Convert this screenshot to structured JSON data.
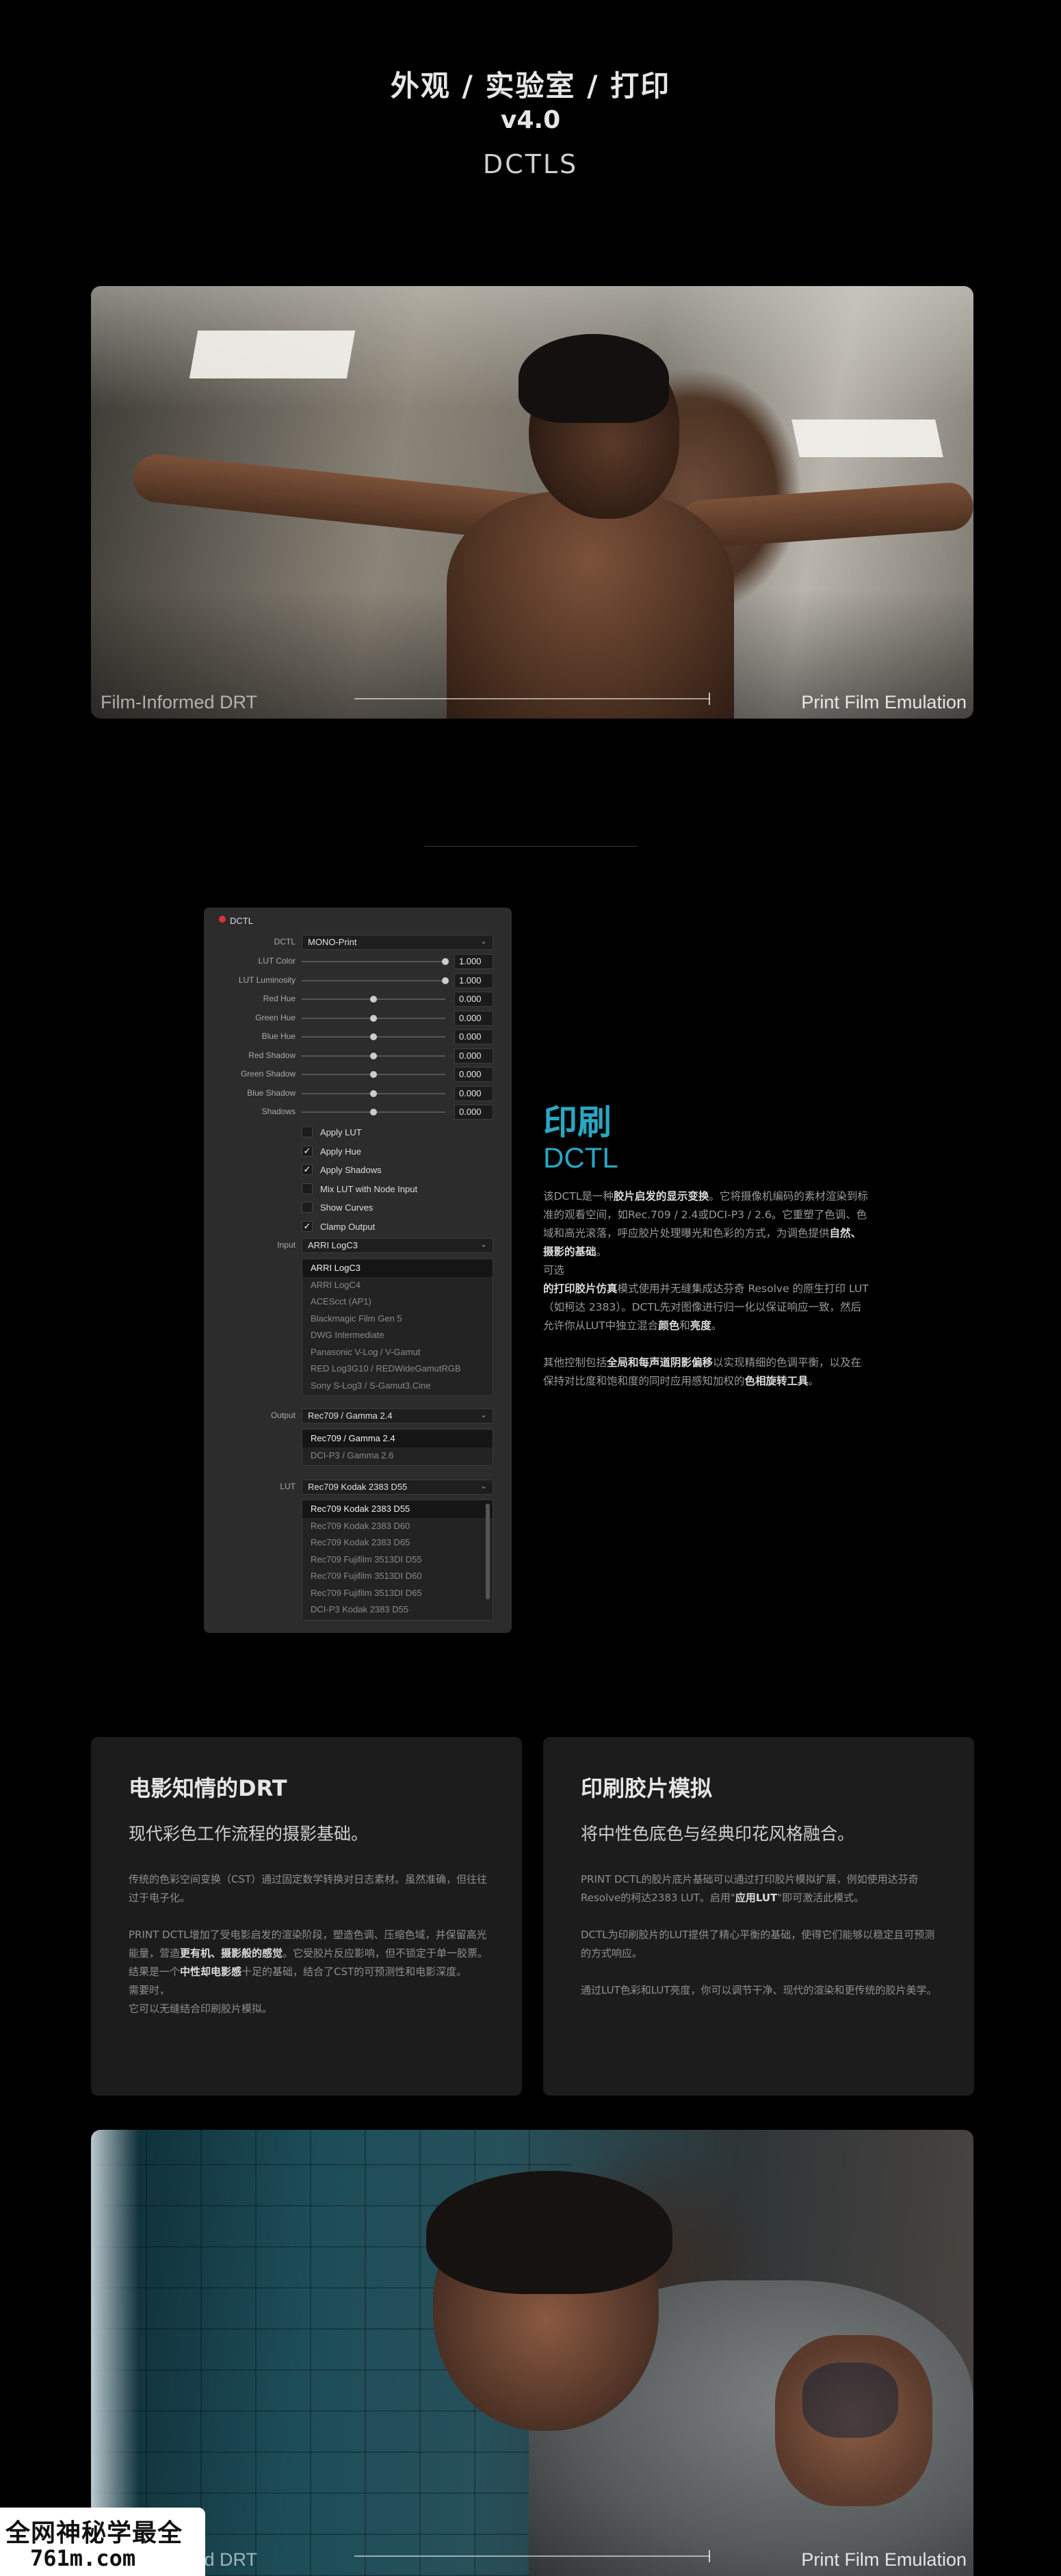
{
  "header": {
    "title": "外观 / 实验室 / 打印",
    "version": "v4.0",
    "subtitle": "DCTLS"
  },
  "hero1": {
    "caption_left": "Film-Informed DRT",
    "caption_right": "Print Film Emulation"
  },
  "panel": {
    "title": "DCTL",
    "dctl_label": "DCTL",
    "dctl_value": "MONO-Print",
    "sliders": [
      {
        "label": "LUT Color",
        "value": "1.000",
        "level": 1.0
      },
      {
        "label": "LUT Luminosity",
        "value": "1.000",
        "level": 1.0
      },
      {
        "label": "Red Hue",
        "value": "0.000",
        "level": 0.5
      },
      {
        "label": "Green Hue",
        "value": "0.000",
        "level": 0.5
      },
      {
        "label": "Blue Hue",
        "value": "0.000",
        "level": 0.5
      },
      {
        "label": "Red Shadow",
        "value": "0.000",
        "level": 0.5
      },
      {
        "label": "Green Shadow",
        "value": "0.000",
        "level": 0.5
      },
      {
        "label": "Blue Shadow",
        "value": "0.000",
        "level": 0.5
      },
      {
        "label": "Shadows",
        "value": "0.000",
        "level": 0.5
      }
    ],
    "checkboxes": [
      {
        "label": "Apply LUT",
        "checked": false
      },
      {
        "label": "Apply Hue",
        "checked": true
      },
      {
        "label": "Apply Shadows",
        "checked": true
      },
      {
        "label": "Mix LUT with Node Input",
        "checked": false
      },
      {
        "label": "Show Curves",
        "checked": false
      },
      {
        "label": "Clamp Output",
        "checked": true
      }
    ],
    "check_glyph": "✓",
    "chevron": "⌄",
    "input_label": "Input",
    "input_value": "ARRI LogC3",
    "input_options": [
      "ARRI LogC3",
      "ARRI LogC4",
      "ACEScct (AP1)",
      "Blackmagic Film Gen 5",
      "DWG Intermediate",
      "Panasonic V-Log / V-Gamut",
      "RED Log3G10 / REDWideGamutRGB",
      "Sony S-Log3 / S-Gamut3.Cine"
    ],
    "output_label": "Output",
    "output_value": "Rec709 / Gamma 2.4",
    "output_options": [
      "Rec709 / Gamma 2.4",
      "DCI-P3 / Gamma 2.6"
    ],
    "lut_label": "LUT",
    "lut_value": "Rec709 Kodak 2383 D55",
    "lut_options": [
      "Rec709 Kodak 2383 D55",
      "Rec709 Kodak 2383 D60",
      "Rec709 Kodak 2383 D65",
      "Rec709 Fujifilm 3513DI D55",
      "Rec709 Fujifilm 3513DI D60",
      "Rec709 Fujifilm 3513DI D65",
      "DCI-P3 Kodak 2383 D55"
    ]
  },
  "print": {
    "title": "印刷",
    "subtitle": "DCTL",
    "p1_a": "该DCTL是一种",
    "p1_b": "胶片启发的显示变换",
    "p1_c": "。它将摄像机编码的素材渲染到标准的观看空间，如Rec.709 / 2.4或DCI-P3 / 2.6。它重塑了色调、色域和高光滚落，呼应胶片处理曝光和色彩的方式，为调色提供",
    "p1_d": "自然、摄影的基础",
    "p1_e": "。",
    "p2_a": "可选",
    "p2_b": "的打印胶片仿真",
    "p2_c": "模式使用并无缝集成达芬奇 Resolve 的原生打印 LUT（如柯达 2383）。DCTL先对图像进行归一化以保证响应一致，然后允许你从LUT中独立混合",
    "p2_d": "颜色",
    "p2_e": "和",
    "p2_f": "亮度",
    "p2_g": "。",
    "p3_a": "其他控制包括",
    "p3_b": "全局和每声道阴影偏移",
    "p3_c": "以实现精细的色调平衡，以及在保持对比度和饱和度的同时应用感知加权的",
    "p3_d": "色相旋转工具",
    "p3_e": "。"
  },
  "card_left": {
    "title": "电影知情的DRT",
    "subtitle": "现代彩色工作流程的摄影基础。",
    "p1": "传统的色彩空间变换（CST）通过固定数学转换对日志素材。虽然准确，但往往过于电子化。",
    "p2_a": "PRINT DCTL增加了受电影启发的渲染阶段，塑造色调、压缩色域，并保留高光能量，营造",
    "p2_b": "更有机、摄影般的感觉",
    "p2_c": "。它受胶片反应影响，但不锁定于单一胶票。结果是一个",
    "p2_d": "中性却电影感",
    "p2_e": "十足的基础，结合了CST的可预测性和电影深度。",
    "p2_f": "需要时，",
    "p2_g": "它可以无缝结合印刷胶片模拟。"
  },
  "card_right": {
    "title": "印刷胶片模拟",
    "subtitle": "将中性色底色与经典印花风格融合。",
    "p1_a": "PRINT DCTL的胶片底片基础可以通过打印胶片模拟扩展，例如使用达芬奇Resolve的柯达2383 LUT。启用\"",
    "p1_b": "应用LUT",
    "p1_c": "\"即可激活此模式。",
    "p2": "DCTL为印刷胶片的LUT提供了精心平衡的基础，使得它们能够以稳定且可预测的方式响应。",
    "p3": "通过LUT色彩和LUT亮度，你可以调节干净、现代的渲染和更传统的胶片美学。"
  },
  "hero2": {
    "caption_left": "Film-Informed DRT",
    "caption_right": "Print Film Emulation"
  },
  "watermark": {
    "line1": "全网神秘学最全",
    "line2": "761m.com"
  }
}
